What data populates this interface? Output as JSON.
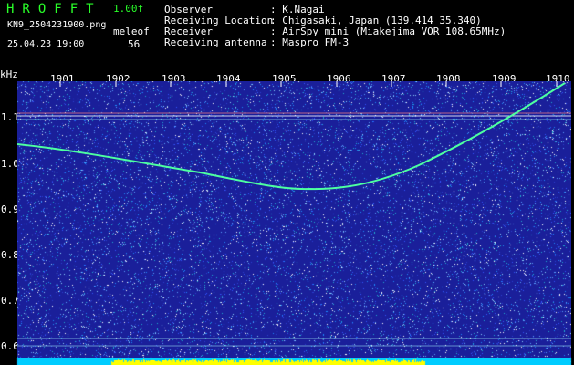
{
  "header": {
    "app_title": "HROFFT",
    "version": "1.00f",
    "filename": "KN9_2504231900.png",
    "meleof_label": "meleof",
    "meleof_value": "56",
    "datetime": "25.04.23 19:00",
    "fields": [
      {
        "label": "Observer",
        "value": ": K.Nagai"
      },
      {
        "label": "Receiving Location",
        "value": ": Chigasaki, Japan (139.414 35.340)"
      },
      {
        "label": "Receiver",
        "value": ": AirSpy mini (Miakejima VOR 108.65MHz)"
      },
      {
        "label": "Receiving antenna",
        "value": ": Maspro FM-3"
      }
    ]
  },
  "spectrogram": {
    "y_unit": "kHz",
    "x_ticks": [
      "1901",
      "1902",
      "1903",
      "1904",
      "1905",
      "1906",
      "1907",
      "1908",
      "1909",
      "1910"
    ],
    "y_ticks": [
      "1.1",
      "1.0",
      "0.9",
      "0.8",
      "0.7",
      "0.6"
    ],
    "colors": {
      "background": "#1a1f9a",
      "trace": "#4dffa0",
      "label_green": "#29ff29",
      "bottom_strip": "#00ccff",
      "bottom_bars": "#ffff00"
    }
  }
}
